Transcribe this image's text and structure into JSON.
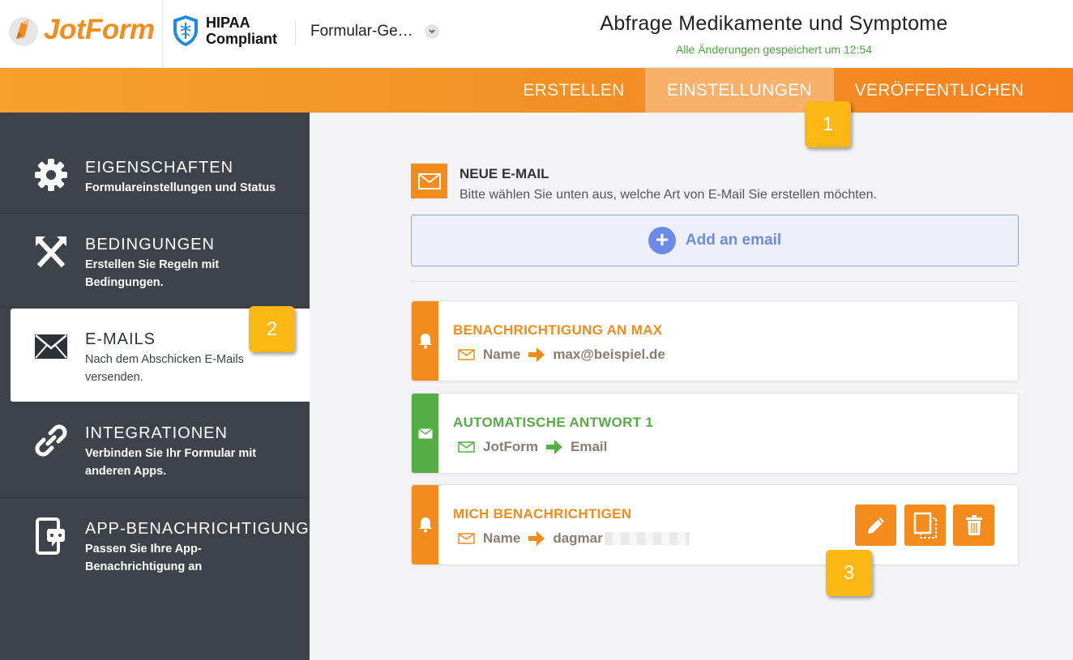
{
  "header": {
    "logo_text": "JotForm",
    "hipaa_line1": "HIPAA",
    "hipaa_line2": "Compliant",
    "form_selector": "Formular-Ge…",
    "form_title": "Abfrage Medikamente und Symptome",
    "save_status": "Alle Änderungen gespeichert um 12:54"
  },
  "nav": {
    "tabs": [
      {
        "label": "ERSTELLEN",
        "active": false
      },
      {
        "label": "EINSTELLUNGEN",
        "active": true
      },
      {
        "label": "VERÖFFENTLICHEN",
        "active": false
      }
    ]
  },
  "sidebar": {
    "items": [
      {
        "icon": "gear-icon",
        "title": "EIGENSCHAFTEN",
        "desc": "Formulareinstellungen und Status",
        "active": false
      },
      {
        "icon": "conditions-icon",
        "title": "BEDINGUNGEN",
        "desc": "Erstellen Sie Regeln mit Bedingungen.",
        "active": false
      },
      {
        "icon": "envelope-icon",
        "title": "E-MAILS",
        "desc": "Nach dem Abschicken E-Mails versenden.",
        "active": true
      },
      {
        "icon": "link-icon",
        "title": "INTEGRATIONEN",
        "desc": "Verbinden Sie Ihr Formular mit anderen Apps.",
        "active": false
      },
      {
        "icon": "mobile-notification-icon",
        "title": "APP-BENACHRICHTIGUNG",
        "desc": "Passen Sie Ihre App-Benachrichtigung an",
        "active": false
      }
    ]
  },
  "main": {
    "new_email_title": "NEUE E-MAIL",
    "new_email_subtitle": "Bitte wählen Sie unten aus, welche Art von E-Mail Sie erstellen möchten.",
    "add_email_label": "Add an email",
    "emails": [
      {
        "type": "notification",
        "title": "BENACHRICHTIGUNG AN MAX",
        "from": "Name",
        "to": "max@beispiel.de",
        "color": "#f38b1d",
        "icon": "bell-icon"
      },
      {
        "type": "autoresponder",
        "title": "AUTOMATISCHE ANTWORT 1",
        "from": "JotForm",
        "to": "Email",
        "color": "#57ad45",
        "icon": "envelope-icon"
      },
      {
        "type": "notification",
        "title": "MICH BENACHRICHTIGEN",
        "from": "Name",
        "to": "dagmar",
        "color": "#f38b1d",
        "icon": "bell-icon"
      }
    ],
    "action_icons": [
      "edit-icon",
      "clone-icon",
      "delete-icon"
    ]
  },
  "callouts": [
    "1",
    "2",
    "3"
  ],
  "colors": {
    "brand_orange": "#f38b1d",
    "sidebar_bg": "#3e4249",
    "autoresponder_green": "#57ad45",
    "add_email_blue": "#6d8be6",
    "callout_yellow": "#fbb714"
  }
}
